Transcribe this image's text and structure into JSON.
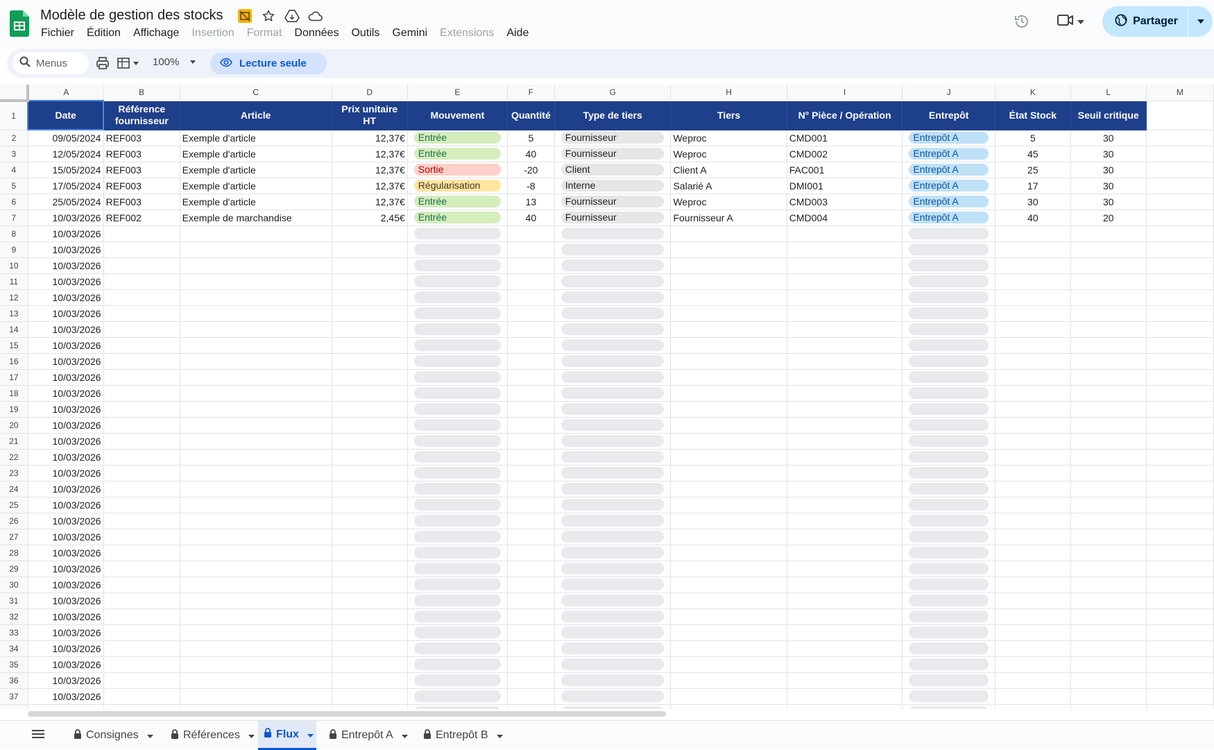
{
  "app": {
    "doc_title": "Modèle de gestion des stocks",
    "menu": [
      "Fichier",
      "Édition",
      "Affichage",
      "Insertion",
      "Format",
      "Données",
      "Outils",
      "Gemini",
      "Extensions",
      "Aide"
    ],
    "menu_disabled": [
      false,
      false,
      false,
      true,
      true,
      false,
      false,
      false,
      true,
      false
    ],
    "share_label": "Partager"
  },
  "toolbar": {
    "search_label": "Menus",
    "zoom": "100%",
    "read_only_label": "Lecture seule"
  },
  "sheet": {
    "column_letters": [
      "A",
      "B",
      "C",
      "D",
      "E",
      "F",
      "G",
      "H",
      "I",
      "J",
      "K",
      "L",
      "M"
    ],
    "headers": [
      "Date",
      "Référence fournisseur",
      "Article",
      "Prix unitaire HT",
      "Mouvement",
      "Quantité",
      "Type de tiers",
      "Tiers",
      "N° Pièce / Opération",
      "Entrepôt",
      "État Stock",
      "Seuil critique"
    ],
    "rows": [
      [
        "09/05/2024",
        "REF003",
        "Exemple d'article",
        "12,37€",
        "Entrée",
        "5",
        "Fournisseur",
        "Weproc",
        "CMD001",
        "Entrepôt A",
        "5",
        "30"
      ],
      [
        "12/05/2024",
        "REF003",
        "Exemple d'article",
        "12,37€",
        "Entrée",
        "40",
        "Fournisseur",
        "Weproc",
        "CMD002",
        "Entrepôt A",
        "45",
        "30"
      ],
      [
        "15/05/2024",
        "REF003",
        "Exemple d'article",
        "12,37€",
        "Sortie",
        "-20",
        "Client",
        "Client A",
        "FAC001",
        "Entrepôt A",
        "25",
        "30"
      ],
      [
        "17/05/2024",
        "REF003",
        "Exemple d'article",
        "12,37€",
        "Régularisation",
        "-8",
        "Interne",
        "Salarié A",
        "DMI001",
        "Entrepôt A",
        "17",
        "30"
      ],
      [
        "25/05/2024",
        "REF003",
        "Exemple d'article",
        "12,37€",
        "Entrée",
        "13",
        "Fournisseur",
        "Weproc",
        "CMD003",
        "Entrepôt A",
        "30",
        "30"
      ],
      [
        "10/03/2026",
        "REF002",
        "Exemple de marchandise",
        "2,45€",
        "Entrée",
        "40",
        "Fournisseur",
        "Fournisseur A",
        "CMD004",
        "Entrepôt A",
        "40",
        "20"
      ]
    ],
    "empty_row_date": "10/03/2026",
    "empty_row_count": 31,
    "colors": {
      "header_bg": "#1e3f8a",
      "entree": "#d4edbc",
      "sortie": "#ffcfc9",
      "regularisation": "#ffe5a0",
      "entrepot": "#bfe1f6"
    }
  },
  "tabs": [
    {
      "label": "Consignes",
      "active": false,
      "locked": true
    },
    {
      "label": "Références",
      "active": false,
      "locked": true
    },
    {
      "label": "Flux",
      "active": true,
      "locked": true
    },
    {
      "label": "Entrepôt A",
      "active": false,
      "locked": true
    },
    {
      "label": "Entrepôt B",
      "active": false,
      "locked": true
    }
  ],
  "icons": [
    "sheets-logo-icon",
    "slides-badge-icon",
    "star-icon",
    "move-to-drive-icon",
    "cloud-status-icon",
    "history-icon",
    "meet-icon",
    "globe-icon",
    "search-icon",
    "print-icon",
    "format-painter-icon",
    "eye-icon",
    "all-sheets-icon",
    "lock-icon"
  ]
}
